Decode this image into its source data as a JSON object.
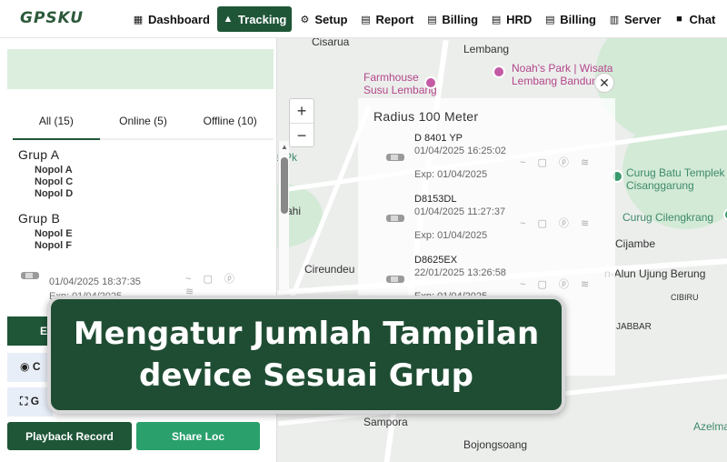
{
  "app": {
    "logo": "GPSKU"
  },
  "nav": [
    {
      "label": "Dashboard",
      "icon": "grid-icon",
      "glyph": "▦"
    },
    {
      "label": "Tracking",
      "icon": "navigation-arrow-icon",
      "glyph": "▲",
      "active": true
    },
    {
      "label": "Setup",
      "icon": "gear-icon",
      "glyph": "⚙"
    },
    {
      "label": "Report",
      "icon": "document-icon",
      "glyph": "▤"
    },
    {
      "label": "Billing",
      "icon": "receipt-icon",
      "glyph": "▤"
    },
    {
      "label": "HRD",
      "icon": "document-icon",
      "glyph": "▤"
    },
    {
      "label": "Billing",
      "icon": "receipt-icon",
      "glyph": "▤"
    },
    {
      "label": "Server",
      "icon": "server-icon",
      "glyph": "▥"
    },
    {
      "label": "Chat",
      "icon": "chat-icon",
      "glyph": "■"
    }
  ],
  "tabs": [
    "All (15)",
    "Online (5)",
    "Offline (10)"
  ],
  "groups": [
    {
      "name": "Grup A",
      "items": [
        "Nopol A",
        "Nopol C",
        "Nopol D"
      ]
    },
    {
      "name": "Grup B",
      "items": [
        "Nopol E",
        "Nopol F"
      ]
    }
  ],
  "list_vehicle": {
    "datetime": "01/04/2025 18:37:35",
    "exp": "Exp: 01/04/2025"
  },
  "side_buttons": [
    "E",
    "C",
    "G"
  ],
  "buttons": {
    "playback": "Playback Record",
    "share": "Share Loc"
  },
  "popup": {
    "title": "Radius 100 Meter",
    "vehicles": [
      {
        "plate": "D 8401 YP",
        "datetime": "01/04/2025 16:25:02",
        "exp": "Exp: 01/04/2025"
      },
      {
        "plate": "D8153DL",
        "datetime": "01/04/2025 11:27:37",
        "exp": "Exp: 01/04/2025"
      },
      {
        "plate": "D8625EX",
        "datetime": "22/01/2025 13:26:58",
        "exp": "Exp: 01/04/2025"
      }
    ]
  },
  "map": {
    "zoom_in": "+",
    "zoom_out": "−",
    "labels": {
      "cisarua": "Cisarua",
      "lembang": "Lembang",
      "farmhouse": "Farmhouse\nSusu Lembang",
      "noahs": "Noah's Park | Wisata\nLembang Bandung",
      "curug_batu": "Curug Batu Templek\nCisanggarung",
      "curug_cil": "Curug Cilengkrang",
      "cijambe": "Cijambe",
      "sukahi": "ahi",
      "cireundeu": "Cireundeu",
      "alun": "n-Alun Ujung Berung",
      "cibiru": "CIBIRU",
      "jabbar": "JABBAR",
      "sampora": "Sampora",
      "bojongsoang": "Bojongsoang",
      "azelma": "Azelma",
      "park": "re Pk"
    }
  },
  "caption": {
    "line1": "Mengatur Jumlah Tampilan",
    "line2": "device Sesuai Grup"
  }
}
